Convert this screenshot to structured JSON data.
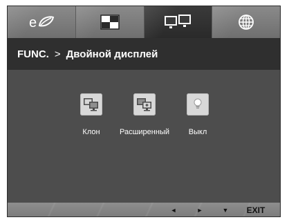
{
  "tabs": [
    {
      "id": "eco",
      "icon": "eco-leaf-icon",
      "active": false
    },
    {
      "id": "picture",
      "icon": "picture-quadrant-icon",
      "active": false
    },
    {
      "id": "dual-display",
      "icon": "dual-display-icon",
      "active": true
    },
    {
      "id": "language",
      "icon": "globe-icon",
      "active": false
    }
  ],
  "breadcrumb": {
    "root": "FUNC.",
    "separator": ">",
    "current": "Двойной дисплей"
  },
  "options": [
    {
      "label": "Клон",
      "icon": "clone-display-icon"
    },
    {
      "label": "Расширенный",
      "icon": "extended-display-icon"
    },
    {
      "label": "Выкл",
      "icon": "off-bulb-icon"
    }
  ],
  "bottom_bar": {
    "left": "◄",
    "right": "►",
    "down": "▼",
    "exit": "EXIT"
  },
  "colors": {
    "panel": "#4d4d4d",
    "title_bar": "#2f2f2f",
    "tab_bar": "#7f7f7f",
    "active_tab": "#2f2f2f",
    "icon_box": "#d8d8d8"
  }
}
